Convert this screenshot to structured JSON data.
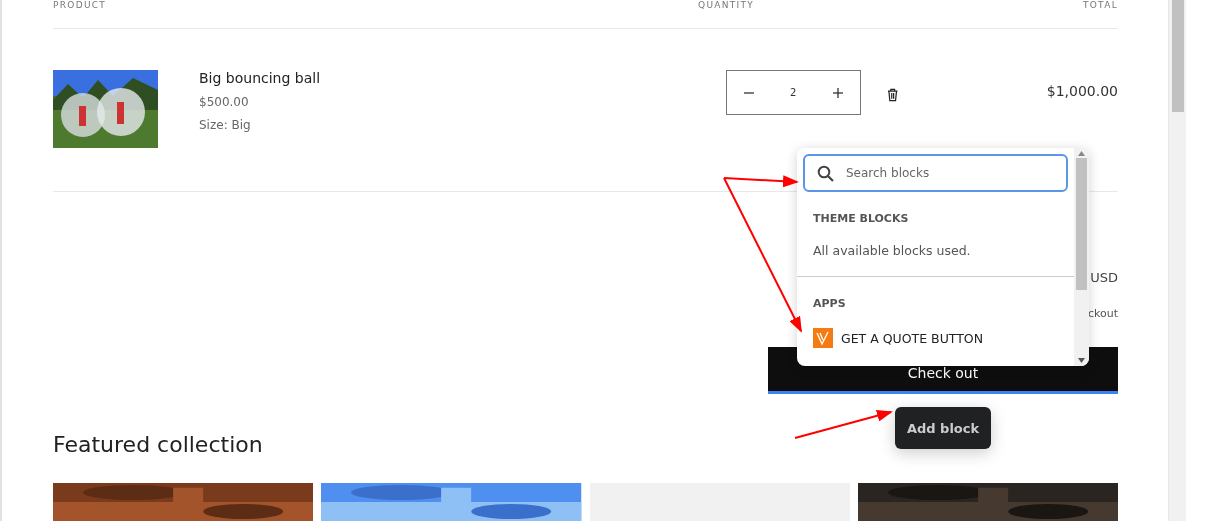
{
  "cart": {
    "columns": [
      "PRODUCT",
      "QUANTITY",
      "TOTAL"
    ],
    "items": [
      {
        "name": "Big bouncing ball",
        "price": "$500.00",
        "option": "Size: Big",
        "quantity": "2",
        "total": "$1,000.00"
      }
    ]
  },
  "summary": {
    "subtotal_fragment": "USD",
    "taxes_fragment": "ckout",
    "checkout_button": "Check out"
  },
  "block_picker": {
    "search": {
      "placeholder": "Search blocks"
    },
    "sections": [
      {
        "kind": "note",
        "title": "THEME BLOCKS",
        "text": "All available blocks used."
      },
      {
        "kind": "apps",
        "title": "APPS",
        "apps": [
          {
            "name": "GET A QUOTE BUTTON"
          }
        ]
      }
    ]
  },
  "tooltip": "Add block",
  "featured": {
    "title": "Featured collection",
    "cards": [
      {
        "kind": "picture"
      },
      {
        "kind": "picture"
      },
      {
        "kind": "blank"
      },
      {
        "kind": "picture"
      }
    ]
  }
}
